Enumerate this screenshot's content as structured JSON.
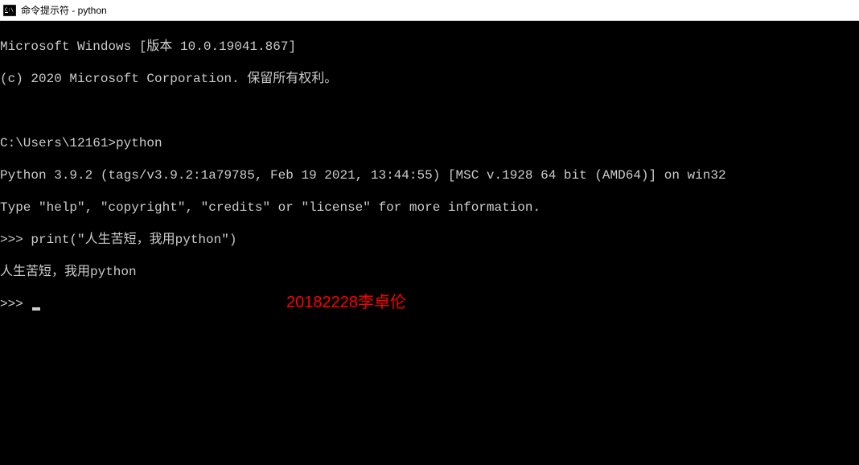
{
  "window": {
    "title": "命令提示符 - python"
  },
  "terminal": {
    "line1": "Microsoft Windows [版本 10.0.19041.867]",
    "line2": "(c) 2020 Microsoft Corporation. 保留所有权利。",
    "line3": "",
    "line4": "C:\\Users\\12161>python",
    "line5": "Python 3.9.2 (tags/v3.9.2:1a79785, Feb 19 2021, 13:44:55) [MSC v.1928 64 bit (AMD64)] on win32",
    "line6": "Type \"help\", \"copyright\", \"credits\" or \"license\" for more information.",
    "line7": ">>> print(\"人生苦短，我用python\")",
    "line8": "人生苦短，我用python",
    "prompt": ">>> "
  },
  "watermark": {
    "text": "20182228李卓伦"
  }
}
